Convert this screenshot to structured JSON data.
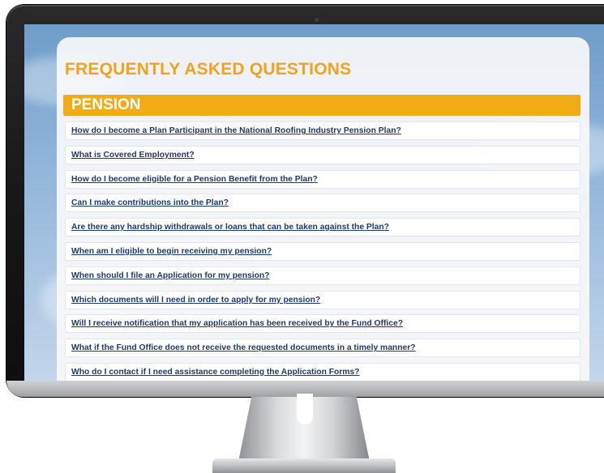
{
  "faq": {
    "title": "FREQUENTLY ASKED QUESTIONS",
    "section": "PENSION",
    "questions": [
      "How do I become a Plan Participant in the National Roofing Industry Pension Plan?",
      "What is Covered Employment?",
      "How do I become eligible for a Pension Benefit from the Plan?",
      "Can I make contributions into the Plan?",
      "Are there any hardship withdrawals or loans that can be taken against the Plan?",
      "When am I eligible to begin receiving my pension?",
      "When should I file an Application for my pension?",
      "Which documents will I need in order to apply for my pension?",
      "Will I receive notification that my application has been received by the Fund Office?",
      "What if the Fund Office does not receive the requested documents in a timely manner?",
      "Who do I contact if I need assistance completing the Application Forms?"
    ]
  },
  "colors": {
    "accent_orange": "#f2ab14",
    "title_orange": "#f3a21b",
    "link_navy": "#1f3a68"
  }
}
